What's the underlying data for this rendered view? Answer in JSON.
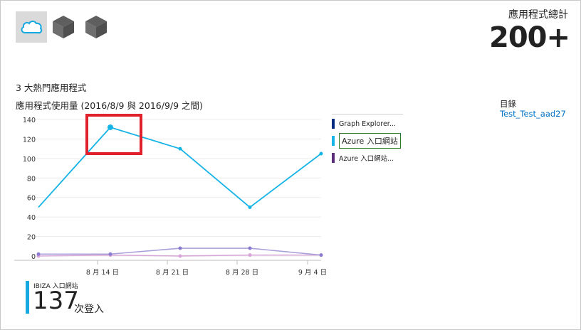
{
  "apps": [
    {
      "icon": "cloud-icon",
      "selected": true
    },
    {
      "icon": "cube-icon",
      "selected": false
    },
    {
      "icon": "cube-icon",
      "selected": false
    }
  ],
  "total": {
    "label": "應用程式總計",
    "value": "200+"
  },
  "section_title": "3 大熱門應用程式",
  "chart_heading": "應用程式使用量 (2016/8/9 與 2016/9/9 之間)",
  "directory": {
    "label": "目錄",
    "value": "Test_Test_aad27"
  },
  "kpi": {
    "app_name": "IBIZA 入口網站",
    "value": "137",
    "unit": "次登入"
  },
  "colors": {
    "accent": "#16a9e1",
    "highlight": "#e0202a",
    "link": "#0072c6"
  },
  "chart_data": {
    "type": "line",
    "x": [
      "8/9",
      "8/14",
      "8/21",
      "8/28",
      "9/4",
      "9/9"
    ],
    "tick_labels": [
      "8 月 14 日",
      "8 月 21 日",
      "8 月 28 日",
      "9 月 4 日"
    ],
    "ylim": [
      0,
      140
    ],
    "yticks": [
      0,
      20,
      40,
      60,
      80,
      100,
      120,
      140
    ],
    "series": [
      {
        "name": "Graph Explorer...",
        "color": "#002b7f",
        "values": [
          0,
          1,
          0,
          1,
          1,
          1
        ],
        "marker_color": "#d9a5d9"
      },
      {
        "name": "Azure 入口網站",
        "color": "#16b4e6",
        "values": [
          50,
          132,
          110,
          50,
          105
        ],
        "marker_color": "#16b4e6"
      },
      {
        "name": "Azure 入口網站...",
        "color": "#5c2d7a",
        "values": [
          2,
          2,
          8,
          8,
          1
        ],
        "marker_color": "#8a7ad0"
      }
    ],
    "legend_active": 1,
    "grid": true
  }
}
